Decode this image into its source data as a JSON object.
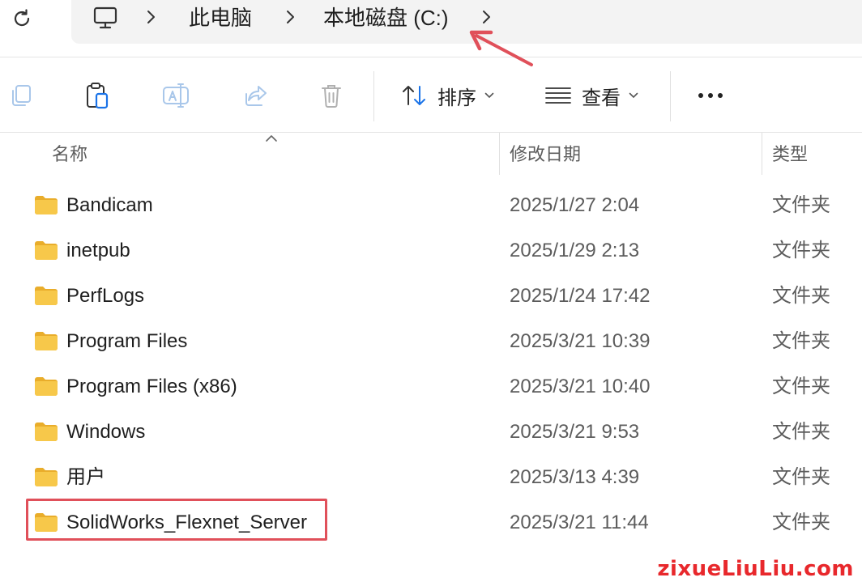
{
  "address_bar": {
    "crumbs": [
      "此电脑",
      "本地磁盘 (C:)"
    ]
  },
  "toolbar": {
    "sort_label": "排序",
    "view_label": "查看"
  },
  "columns": {
    "name": "名称",
    "date": "修改日期",
    "type": "类型"
  },
  "rows": [
    {
      "name": "Bandicam",
      "date": "2025/1/27 2:04",
      "type": "文件夹"
    },
    {
      "name": "inetpub",
      "date": "2025/1/29 2:13",
      "type": "文件夹"
    },
    {
      "name": "PerfLogs",
      "date": "2025/1/24 17:42",
      "type": "文件夹"
    },
    {
      "name": "Program Files",
      "date": "2025/3/21 10:39",
      "type": "文件夹"
    },
    {
      "name": "Program Files (x86)",
      "date": "2025/3/21 10:40",
      "type": "文件夹"
    },
    {
      "name": "Windows",
      "date": "2025/3/21 9:53",
      "type": "文件夹"
    },
    {
      "name": "用户",
      "date": "2025/3/13 4:39",
      "type": "文件夹"
    },
    {
      "name": "SolidWorks_Flexnet_Server",
      "date": "2025/3/21 11:44",
      "type": "文件夹"
    }
  ],
  "watermark": "zixueLiuLiu.com",
  "colors": {
    "annotation_red": "#e0505a",
    "watermark_red": "#e8282c",
    "accent_blue": "#1a73e8",
    "folder_yellow": "#f7c84a"
  }
}
